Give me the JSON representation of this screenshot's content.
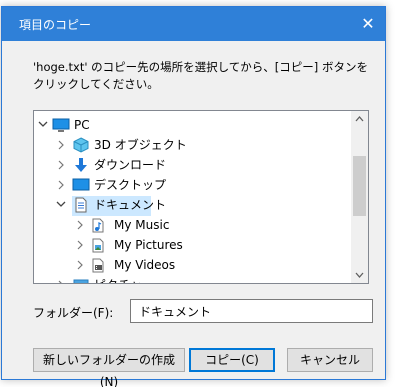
{
  "window": {
    "title": "項目のコピー",
    "close_glyph": "✕"
  },
  "instructions": "'hoge.txt' のコピー先の場所を選択してから、[コピー] ボタンをクリックしてください。",
  "tree": {
    "items": [
      {
        "label": "PC",
        "expanded": true,
        "icon": "computer-icon"
      },
      {
        "label": "3D オブジェクト",
        "icon": "3d-objects-icon"
      },
      {
        "label": "ダウンロード",
        "icon": "downloads-icon"
      },
      {
        "label": "デスクトップ",
        "icon": "desktop-icon"
      },
      {
        "label": "ドキュメント",
        "expanded": true,
        "selected": true,
        "icon": "documents-icon"
      },
      {
        "label": "My Music",
        "icon": "music-folder-icon"
      },
      {
        "label": "My Pictures",
        "icon": "pictures-folder-icon"
      },
      {
        "label": "My Videos",
        "icon": "videos-folder-icon"
      },
      {
        "label": "ピクチャ",
        "icon": "pictures-icon"
      }
    ]
  },
  "folder": {
    "label": "フォルダー(F):",
    "value": "ドキュメント"
  },
  "buttons": {
    "new_folder": "新しいフォルダーの作成(N)",
    "copy": "コピー(C)",
    "cancel": "キャンセル"
  },
  "colors": {
    "titlebar": "#2f80d8",
    "selection": "#cce8ff"
  }
}
